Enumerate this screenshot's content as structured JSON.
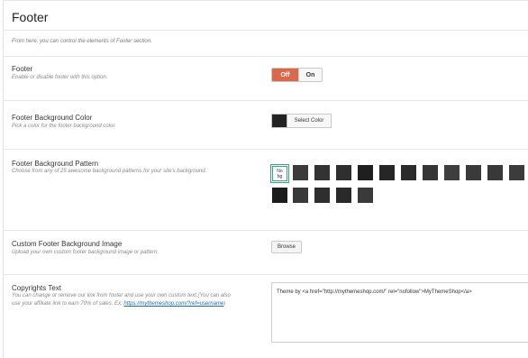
{
  "header": {
    "title": "Footer"
  },
  "intro": "From here, you can control the elements of Footer section.",
  "footer_toggle": {
    "title": "Footer",
    "desc": "Enable or disable footer with this option.",
    "off_label": "Off",
    "on_label": "On",
    "active": "Off",
    "active_color": "#d9684d"
  },
  "bg_color": {
    "title": "Footer Background Color",
    "desc": "Pick a color for the footer background color.",
    "button_label": "Select Color",
    "value": "#222222"
  },
  "bg_pattern": {
    "title": "Footer Background Pattern",
    "desc": "Choose from any of 25 awesome background patterns for your site's background.",
    "no_bg_line1": "No",
    "no_bg_line2": "bg",
    "selected": "No bg"
  },
  "bg_image": {
    "title": "Custom Footer Background Image",
    "desc": "Upload your own custom footer background image or pattern.",
    "button_label": "Browse"
  },
  "copyrights": {
    "title": "Copyrights Text",
    "desc_line1": "You can change or remove our link from footer and use your own custom text.(You can also",
    "desc_line2": "use your affiliate link to earn 70% of sales. Ex: ",
    "link_text": "https://mythemeshop.com/?ref=username",
    "desc_end": ")",
    "value": "Theme by <a href=\"http://mythemeshop.com/\" rel=\"nofollow\">MyThemeShop</a>"
  }
}
